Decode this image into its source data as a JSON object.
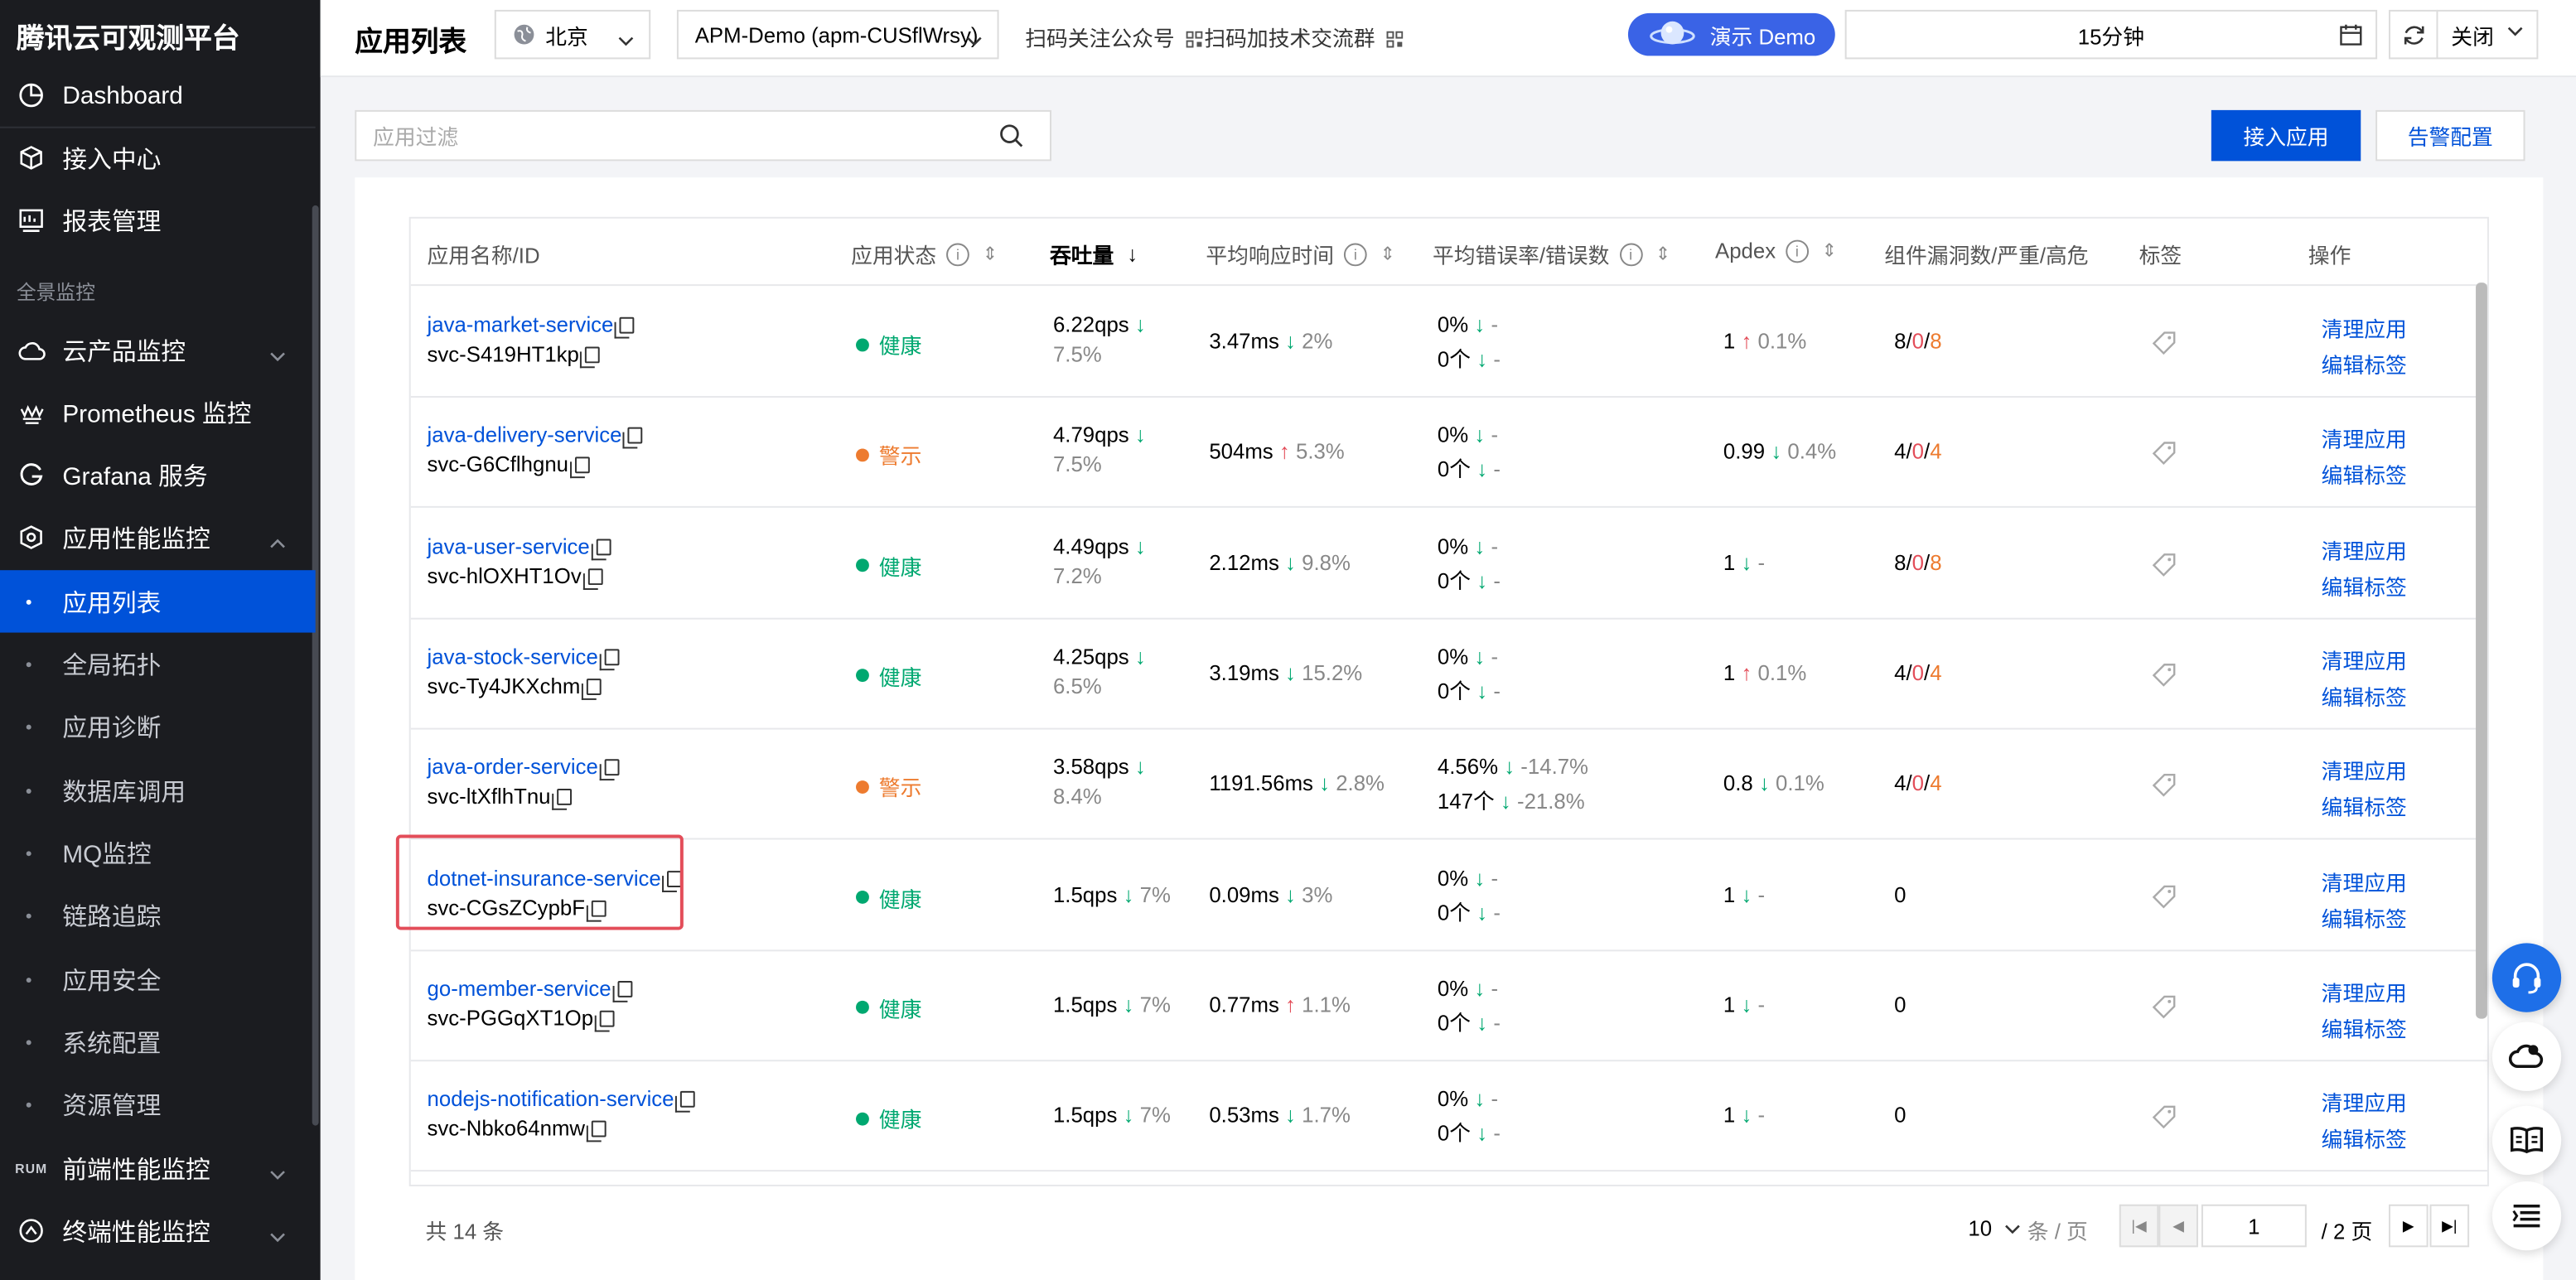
{
  "sidebar": {
    "brand": "腾讯云可观测平台",
    "top_items": [
      {
        "label": "Dashboard",
        "icon": "dashboard-icon"
      },
      {
        "label": "接入中心",
        "icon": "cube-icon"
      },
      {
        "label": "报表管理",
        "icon": "report-icon"
      }
    ],
    "section_label": "全景监控",
    "groups": [
      {
        "label": "云产品监控",
        "icon": "cloud-icon",
        "expanded": false
      },
      {
        "label": "Prometheus 监控",
        "icon": "prometheus-icon"
      },
      {
        "label": "Grafana 服务",
        "icon": "grafana-icon"
      },
      {
        "label": "应用性能监控",
        "icon": "apm-icon",
        "expanded": true
      }
    ],
    "apm_sub_items": [
      {
        "label": "应用列表",
        "active": true
      },
      {
        "label": "全局拓扑"
      },
      {
        "label": "应用诊断"
      },
      {
        "label": "数据库调用"
      },
      {
        "label": "MQ监控"
      },
      {
        "label": "链路追踪"
      },
      {
        "label": "应用安全"
      },
      {
        "label": "系统配置"
      },
      {
        "label": "资源管理"
      }
    ],
    "bottom_groups": [
      {
        "label": "前端性能监控",
        "icon_text": "RUM"
      },
      {
        "label": "终端性能监控",
        "icon": "terminal-icon"
      }
    ]
  },
  "header": {
    "title": "应用列表",
    "region": "北京",
    "instance": "APM-Demo (apm-CUSflWrsy)",
    "qr_follow": "扫码关注公众号",
    "qr_group": "扫码加技术交流群",
    "demo_label": "演示 Demo",
    "time_range": "15分钟",
    "auto_refresh": "关闭"
  },
  "toolbar": {
    "filter_placeholder": "应用过滤",
    "connect_label": "接入应用",
    "alert_label": "告警配置"
  },
  "table": {
    "columns": [
      "应用名称/ID",
      "应用状态",
      "吞吐量",
      "平均响应时间",
      "平均错误率/错误数",
      "Apdex",
      "组件漏洞数/严重/高危",
      "标签",
      "操作"
    ],
    "action_clean": "清理应用",
    "action_edit": "编辑标签",
    "rows": [
      {
        "name": "java-market-service",
        "id": "svc-S419HT1kp",
        "status": "健康",
        "status_color": "#00a870",
        "qps": "6.22qps",
        "qps_dir": "down",
        "qps_change": "7.5%",
        "resp": "3.47ms",
        "resp_dir": "down",
        "resp_change": "2%",
        "err_rate": "0%",
        "err_rate_dir": "down",
        "err_rate_change": "-",
        "err_count": "0个",
        "err_count_dir": "down",
        "err_count_change": "-",
        "apdex": "1",
        "apdex_dir": "up",
        "apdex_change": "0.1%",
        "vuln_total": "8",
        "vuln_critical": "0",
        "vuln_high": "8"
      },
      {
        "name": "java-delivery-service",
        "id": "svc-G6Cflhgnu",
        "status": "警示",
        "status_color": "#ed7b2f",
        "qps": "4.79qps",
        "qps_dir": "down",
        "qps_change": "7.5%",
        "resp": "504ms",
        "resp_dir": "up",
        "resp_change": "5.3%",
        "err_rate": "0%",
        "err_rate_dir": "down",
        "err_rate_change": "-",
        "err_count": "0个",
        "err_count_dir": "down",
        "err_count_change": "-",
        "apdex": "0.99",
        "apdex_dir": "down",
        "apdex_change": "0.4%",
        "vuln_total": "4",
        "vuln_critical": "0",
        "vuln_high": "4"
      },
      {
        "name": "java-user-service",
        "id": "svc-hlOXHT1Ov",
        "status": "健康",
        "status_color": "#00a870",
        "qps": "4.49qps",
        "qps_dir": "down",
        "qps_change": "7.2%",
        "resp": "2.12ms",
        "resp_dir": "down",
        "resp_change": "9.8%",
        "err_rate": "0%",
        "err_rate_dir": "down",
        "err_rate_change": "-",
        "err_count": "0个",
        "err_count_dir": "down",
        "err_count_change": "-",
        "apdex": "1",
        "apdex_dir": "down",
        "apdex_change": "-",
        "vuln_total": "8",
        "vuln_critical": "0",
        "vuln_high": "8"
      },
      {
        "name": "java-stock-service",
        "id": "svc-Ty4JKXchm",
        "status": "健康",
        "status_color": "#00a870",
        "qps": "4.25qps",
        "qps_dir": "down",
        "qps_change": "6.5%",
        "resp": "3.19ms",
        "resp_dir": "down",
        "resp_change": "15.2%",
        "err_rate": "0%",
        "err_rate_dir": "down",
        "err_rate_change": "-",
        "err_count": "0个",
        "err_count_dir": "down",
        "err_count_change": "-",
        "apdex": "1",
        "apdex_dir": "up",
        "apdex_change": "0.1%",
        "vuln_total": "4",
        "vuln_critical": "0",
        "vuln_high": "4"
      },
      {
        "name": "java-order-service",
        "id": "svc-ltXflhTnu",
        "status": "警示",
        "status_color": "#ed7b2f",
        "qps": "3.58qps",
        "qps_dir": "down",
        "qps_change": "8.4%",
        "resp": "1191.56ms",
        "resp_dir": "down",
        "resp_change": "2.8%",
        "err_rate": "4.56%",
        "err_rate_dir": "down",
        "err_rate_change": "-14.7%",
        "err_count": "147个",
        "err_count_dir": "down",
        "err_count_change": "-21.8%",
        "apdex": "0.8",
        "apdex_dir": "down",
        "apdex_change": "0.1%",
        "vuln_total": "4",
        "vuln_critical": "0",
        "vuln_high": "4"
      },
      {
        "name": "dotnet-insurance-service",
        "id": "svc-CGsZCypbF",
        "status": "健康",
        "status_color": "#00a870",
        "qps": "1.5qps",
        "qps_dir": "down",
        "qps_change": "7%",
        "resp": "0.09ms",
        "resp_dir": "down",
        "resp_change": "3%",
        "err_rate": "0%",
        "err_rate_dir": "down",
        "err_rate_change": "-",
        "err_count": "0个",
        "err_count_dir": "down",
        "err_count_change": "-",
        "apdex": "1",
        "apdex_dir": "down",
        "apdex_change": "-",
        "vuln_total": "0"
      },
      {
        "name": "go-member-service",
        "id": "svc-PGGqXT1Op",
        "status": "健康",
        "status_color": "#00a870",
        "qps": "1.5qps",
        "qps_dir": "down",
        "qps_change": "7%",
        "resp": "0.77ms",
        "resp_dir": "up",
        "resp_change": "1.1%",
        "err_rate": "0%",
        "err_rate_dir": "down",
        "err_rate_change": "-",
        "err_count": "0个",
        "err_count_dir": "down",
        "err_count_change": "-",
        "apdex": "1",
        "apdex_dir": "down",
        "apdex_change": "-",
        "vuln_total": "0"
      },
      {
        "name": "nodejs-notification-service",
        "id": "svc-Nbko64nmw",
        "status": "健康",
        "status_color": "#00a870",
        "qps": "1.5qps",
        "qps_dir": "down",
        "qps_change": "7%",
        "resp": "0.53ms",
        "resp_dir": "down",
        "resp_change": "1.7%",
        "err_rate": "0%",
        "err_rate_dir": "down",
        "err_rate_change": "-",
        "err_count": "0个",
        "err_count_dir": "down",
        "err_count_change": "-",
        "apdex": "1",
        "apdex_dir": "down",
        "apdex_change": "-",
        "vuln_total": "0"
      }
    ]
  },
  "pagination": {
    "total": "共 14 条",
    "page_size": "10",
    "page_unit": "条 / 页",
    "current_page": "1",
    "total_pages": "/ 2 页"
  },
  "float_tools": [
    "support-icon",
    "cloud-chat-icon",
    "docs-icon",
    "list-icon"
  ],
  "colors": {
    "primary": "#0052d9",
    "healthy": "#00a870",
    "warning": "#ed7b2f",
    "danger": "#e34d59",
    "sidebar_bg": "#1b1c20"
  }
}
